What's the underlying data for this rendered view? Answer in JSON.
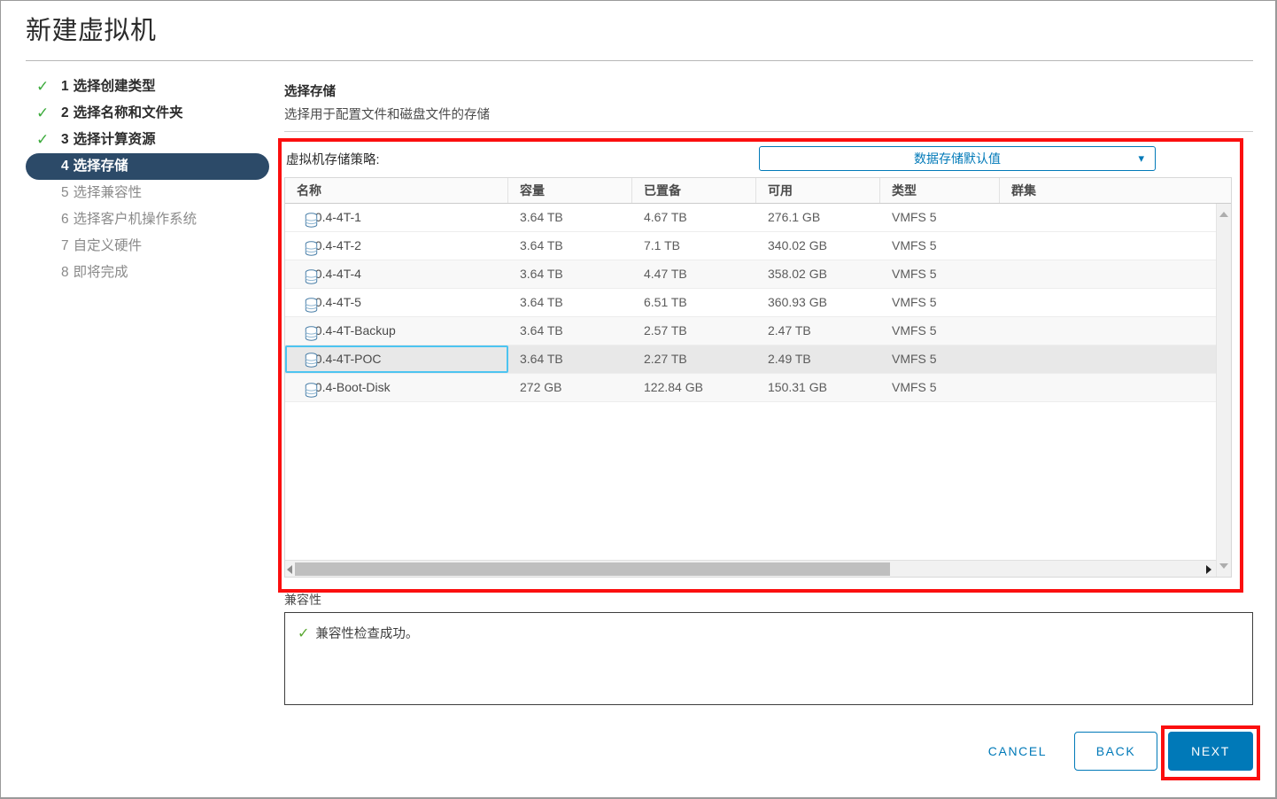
{
  "window": {
    "title": "新建虚拟机"
  },
  "steps": [
    {
      "num": "1",
      "label": "选择创建类型",
      "state": "done"
    },
    {
      "num": "2",
      "label": "选择名称和文件夹",
      "state": "done"
    },
    {
      "num": "3",
      "label": "选择计算资源",
      "state": "done"
    },
    {
      "num": "4",
      "label": "选择存储",
      "state": "current"
    },
    {
      "num": "5",
      "label": "选择兼容性",
      "state": "pending"
    },
    {
      "num": "6",
      "label": "选择客户机操作系统",
      "state": "pending"
    },
    {
      "num": "7",
      "label": "自定义硬件",
      "state": "pending"
    },
    {
      "num": "8",
      "label": "即将完成",
      "state": "pending"
    }
  ],
  "panel": {
    "title": "选择存储",
    "subtitle": "选择用于配置文件和磁盘文件的存储"
  },
  "policy": {
    "label": "虚拟机存储策略:",
    "selected": "数据存储默认值",
    "caret_icon": "chevron-down-icon"
  },
  "table": {
    "columns": [
      "名称",
      "容量",
      "已置备",
      "可用",
      "类型",
      "群集"
    ],
    "row_icon": "datastore-icon",
    "rows": [
      {
        "name": "10.4-4T-1",
        "capacity": "3.64 TB",
        "provisioned": "4.67 TB",
        "free": "276.1 GB",
        "type": "VMFS 5",
        "cluster": "",
        "selected": false
      },
      {
        "name": "10.4-4T-2",
        "capacity": "3.64 TB",
        "provisioned": "7.1 TB",
        "free": "340.02 GB",
        "type": "VMFS 5",
        "cluster": "",
        "selected": false
      },
      {
        "name": "10.4-4T-4",
        "capacity": "3.64 TB",
        "provisioned": "4.47 TB",
        "free": "358.02 GB",
        "type": "VMFS 5",
        "cluster": "",
        "selected": false
      },
      {
        "name": "10.4-4T-5",
        "capacity": "3.64 TB",
        "provisioned": "6.51 TB",
        "free": "360.93 GB",
        "type": "VMFS 5",
        "cluster": "",
        "selected": false
      },
      {
        "name": "10.4-4T-Backup",
        "capacity": "3.64 TB",
        "provisioned": "2.57 TB",
        "free": "2.47 TB",
        "type": "VMFS 5",
        "cluster": "",
        "selected": false
      },
      {
        "name": "10.4-4T-POC",
        "capacity": "3.64 TB",
        "provisioned": "2.27 TB",
        "free": "2.49 TB",
        "type": "VMFS 5",
        "cluster": "",
        "selected": true
      },
      {
        "name": "10.4-Boot-Disk",
        "capacity": "272 GB",
        "provisioned": "122.84 GB",
        "free": "150.31 GB",
        "type": "VMFS 5",
        "cluster": "",
        "selected": false
      }
    ]
  },
  "compatibility": {
    "label": "兼容性",
    "check_icon": "check-icon",
    "message": "兼容性检查成功。"
  },
  "footer": {
    "cancel": "CANCEL",
    "back": "BACK",
    "next": "NEXT"
  },
  "colors": {
    "accent": "#0079b8",
    "current_step_bg": "#2c4a68",
    "success_green": "#5aa832",
    "annotation_red": "#fb0f0f",
    "selection_outline": "#4dc4f0"
  }
}
